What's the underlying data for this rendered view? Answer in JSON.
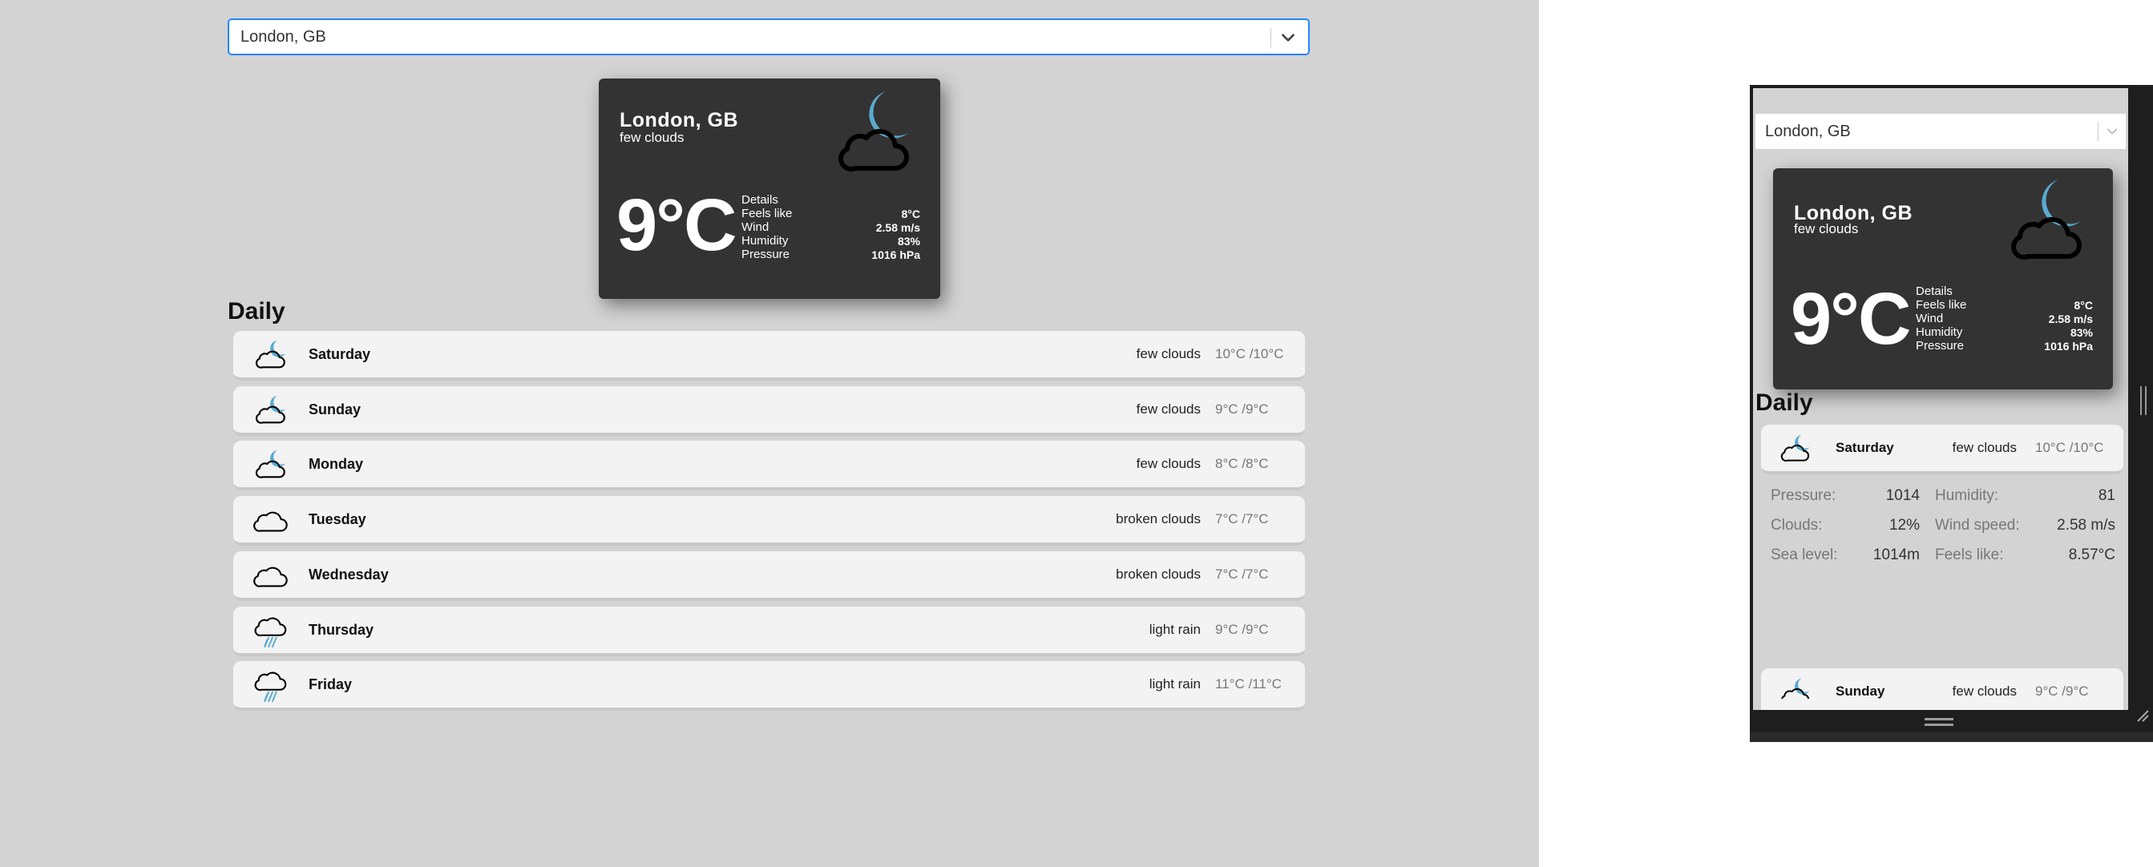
{
  "select": {
    "value": "London, GB"
  },
  "current": {
    "city": "London, GB",
    "description": "few clouds",
    "temperature": "9°C",
    "details": [
      {
        "label": "Details",
        "value": ""
      },
      {
        "label": "Feels like",
        "value": "8°C"
      },
      {
        "label": "Wind",
        "value": "2.58 m/s"
      },
      {
        "label": "Humidity",
        "value": "83%"
      },
      {
        "label": "Pressure",
        "value": "1016 hPa"
      }
    ],
    "icon": "few-clouds-night-icon"
  },
  "daily_heading": "Daily",
  "daily": [
    {
      "day": "Saturday",
      "condition": "few clouds",
      "temps": "10°C /10°C",
      "icon": "few-clouds-night-icon"
    },
    {
      "day": "Sunday",
      "condition": "few clouds",
      "temps": "9°C /9°C",
      "icon": "few-clouds-night-icon"
    },
    {
      "day": "Monday",
      "condition": "few clouds",
      "temps": "8°C /8°C",
      "icon": "few-clouds-night-icon"
    },
    {
      "day": "Tuesday",
      "condition": "broken clouds",
      "temps": "7°C /7°C",
      "icon": "cloud-icon"
    },
    {
      "day": "Wednesday",
      "condition": "broken clouds",
      "temps": "7°C /7°C",
      "icon": "cloud-icon"
    },
    {
      "day": "Thursday",
      "condition": "light rain",
      "temps": "9°C /9°C",
      "icon": "rain-icon"
    },
    {
      "day": "Friday",
      "condition": "light rain",
      "temps": "11°C /11°C",
      "icon": "rain-icon"
    }
  ],
  "expanded_details": {
    "pressure_label": "Pressure:",
    "pressure": "1014",
    "humidity_label": "Humidity:",
    "humidity": "81",
    "clouds_label": "Clouds:",
    "clouds": "12%",
    "wind_label": "Wind speed:",
    "wind": "2.58 m/s",
    "sea_label": "Sea level:",
    "sea": "1014m",
    "feels_label": "Feels like:",
    "feels": "8.57°C"
  },
  "colors": {
    "page_bg": "#d3d3d3",
    "card_bg": "#333333",
    "accent_blue": "#5aaad0",
    "select_border": "#2684ff"
  }
}
